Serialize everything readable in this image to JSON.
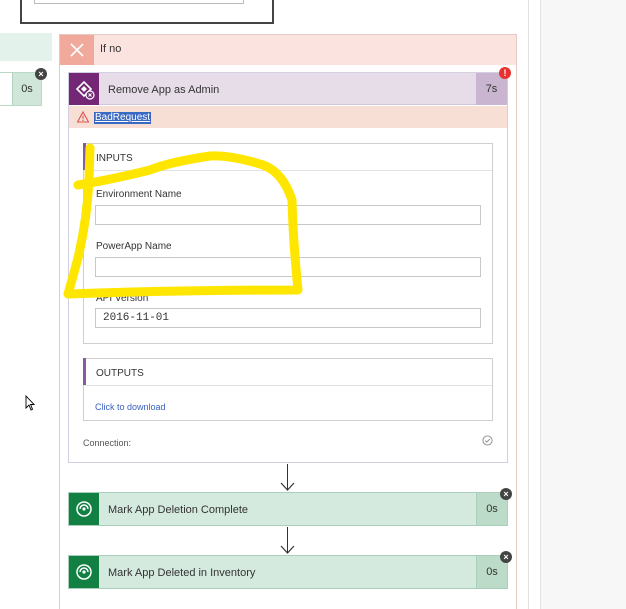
{
  "left_branch": {
    "action_duration": "0s"
  },
  "if_no": {
    "label": "If no",
    "remove_app": {
      "title": "Remove App as Admin",
      "duration": "7s",
      "error_code": "BadRequest",
      "inputs": {
        "header": "INPUTS",
        "fields": [
          {
            "label": "Environment Name",
            "value": ""
          },
          {
            "label": "PowerApp Name",
            "value": ""
          },
          {
            "label": "API Version",
            "value": "2016-11-01"
          }
        ]
      },
      "outputs": {
        "header": "OUTPUTS",
        "link": "Click to download"
      },
      "connection_label": "Connection:"
    },
    "actions": [
      {
        "title": "Mark App Deletion Complete",
        "duration": "0s"
      },
      {
        "title": "Mark App Deleted in Inventory",
        "duration": "0s"
      }
    ]
  },
  "colors": {
    "powerapps_purple": "#742774",
    "dataverse_green": "#138043",
    "error_red": "#e8312f",
    "highlight_yellow": "#ffe600"
  },
  "icons": [
    "close-icon",
    "powerapps-icon",
    "error-icon",
    "warning-icon",
    "check-circle-icon",
    "dataverse-icon",
    "arrow-down-icon",
    "cursor-icon"
  ]
}
